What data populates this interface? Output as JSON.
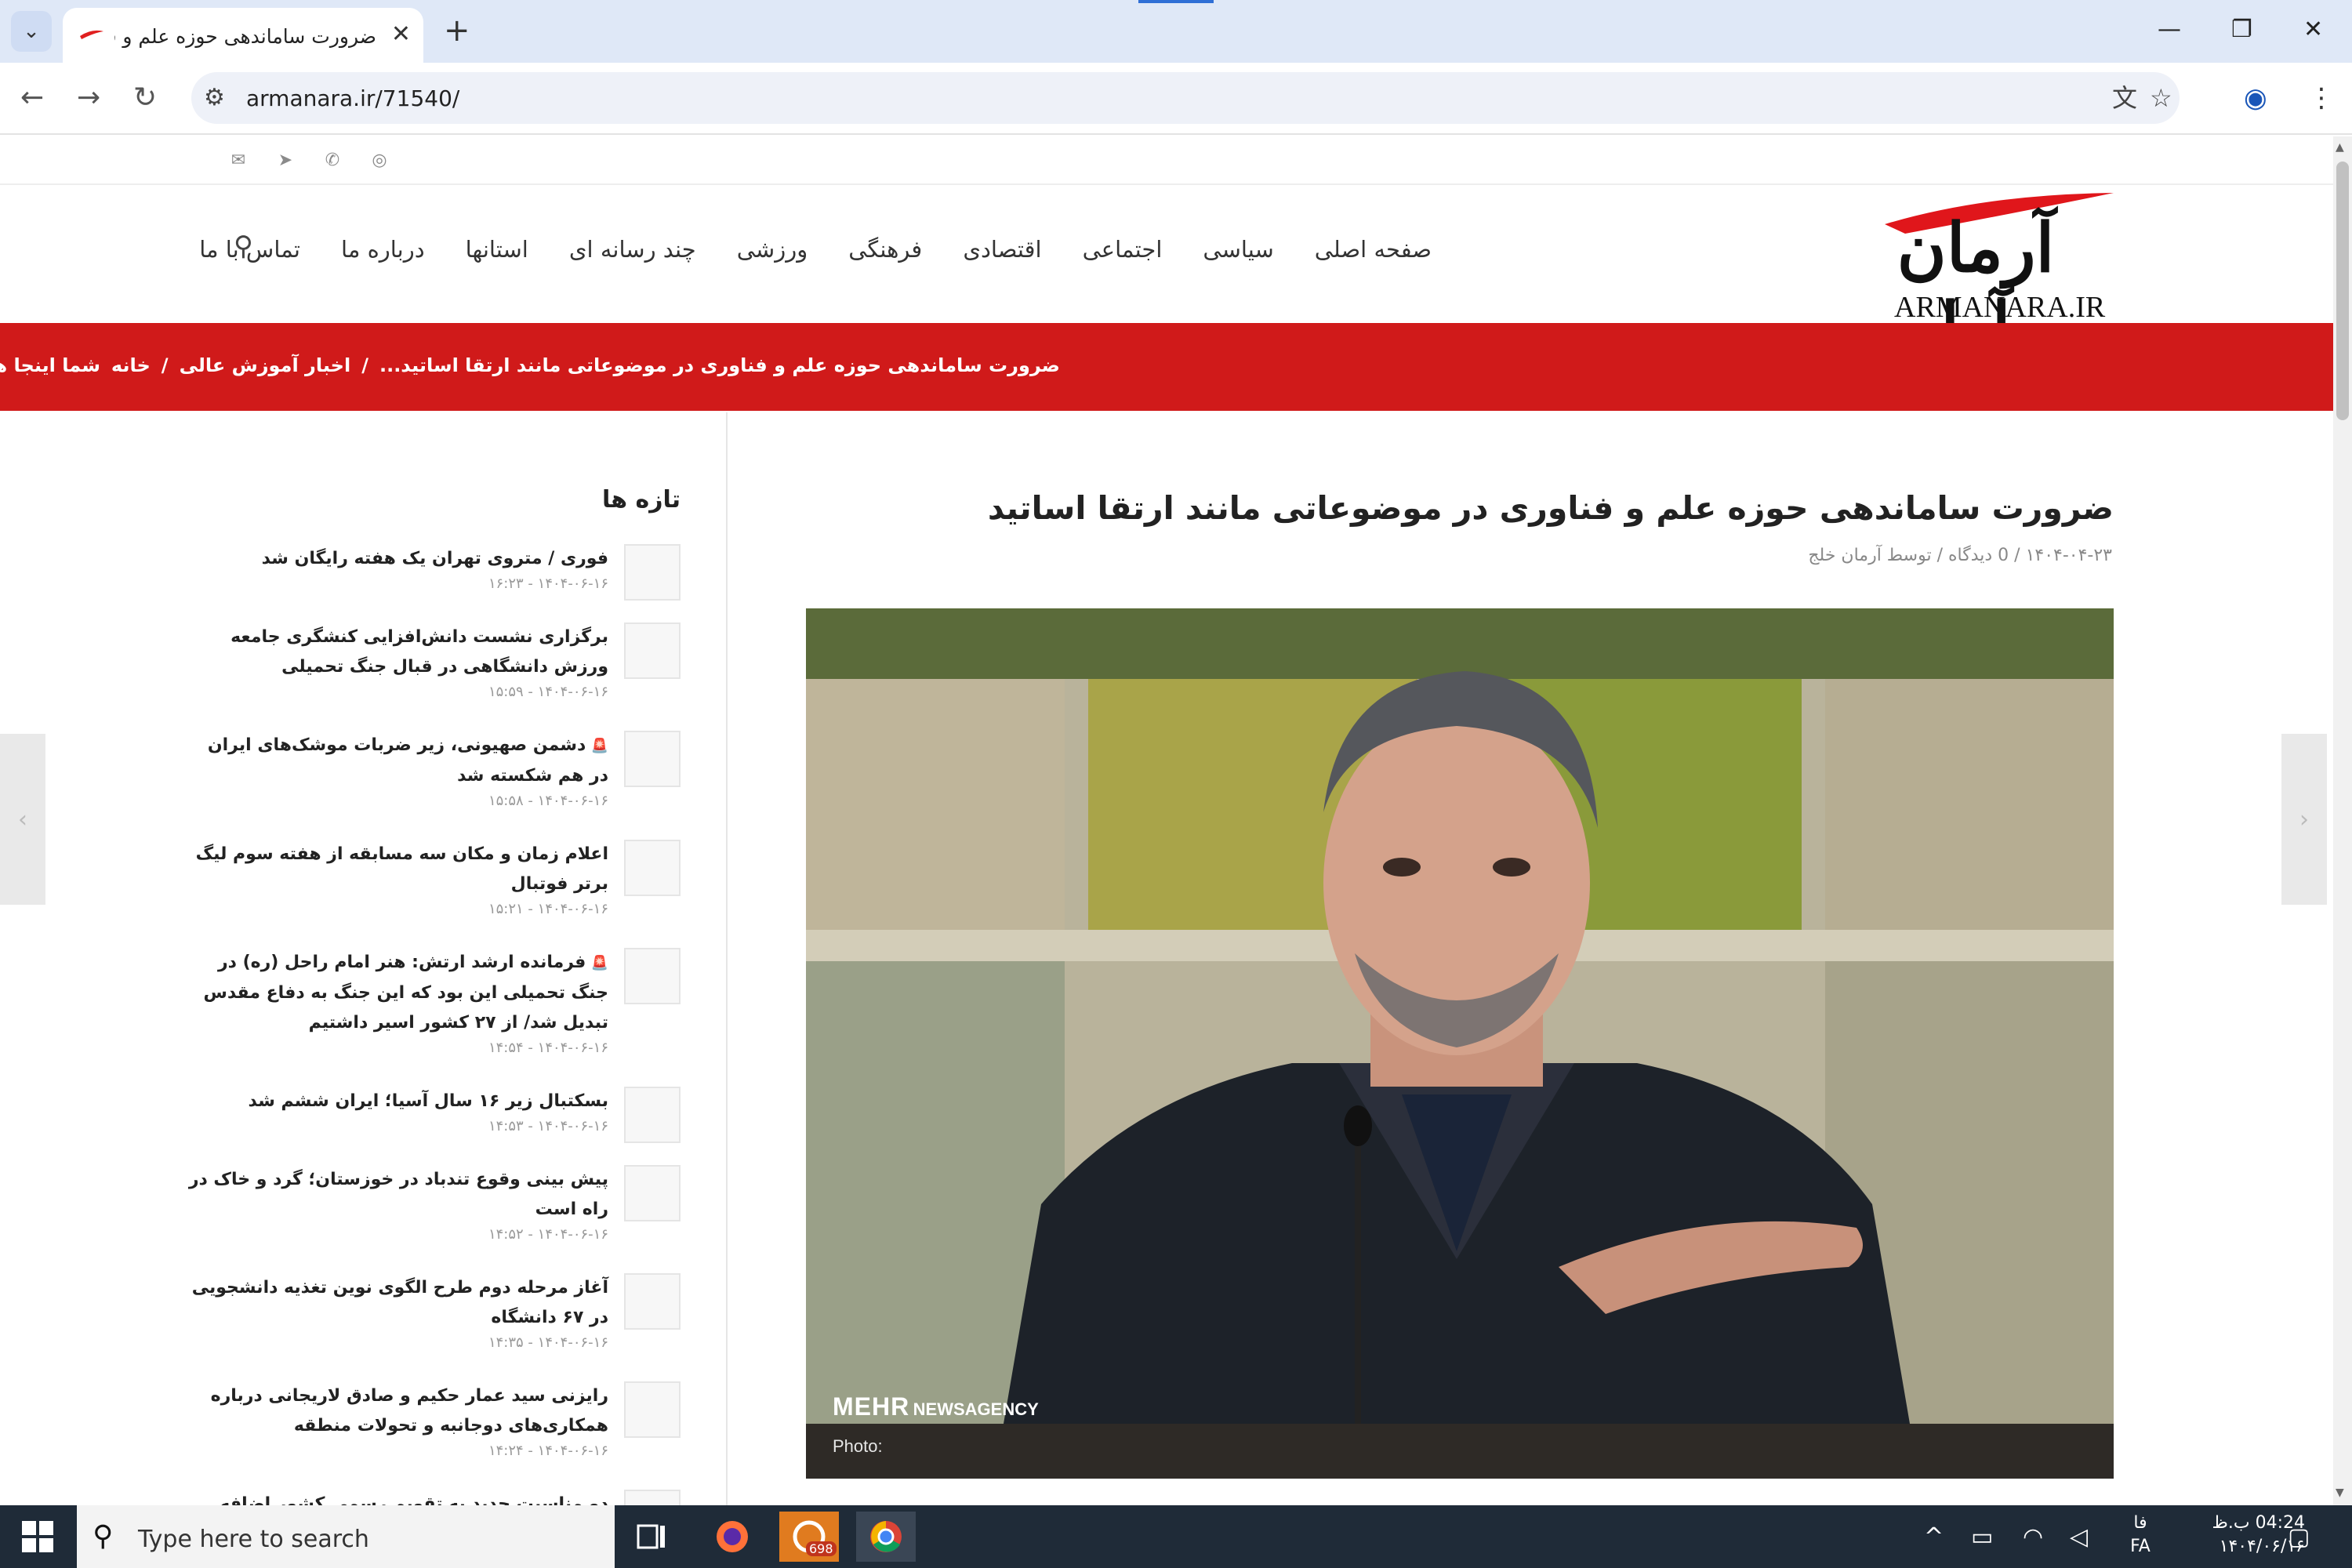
{
  "browser": {
    "tab_title": "ضرورت ساماندهی حوزه علم و فناوری",
    "url": "armanara.ir/71540/",
    "new_tab_glyph": "+",
    "close_glyph": "✕"
  },
  "site": {
    "logo_text": "آرمان آرا",
    "logo_latin": "ARMANARA.IR",
    "nav": [
      "صفحه اصلی",
      "سیاسی",
      "اجتماعی",
      "اقتصادی",
      "فرهنگی",
      "ورزشی",
      "چند رسانه ای",
      "استانها",
      "درباره ما",
      "تماس با ما"
    ],
    "breadcrumb": {
      "prefix": "شما اینجا هستید:",
      "home": "خانه",
      "sep": "/",
      "category": "اخبار آموزش عالی",
      "current": "ضرورت ساماندهی حوزه علم و فناوری در موضوعاتی مانند ارتقا اساتید..."
    }
  },
  "article": {
    "title": "ضرورت ساماندهی حوزه علم و فناوری در موضوعاتی مانند ارتقا اساتید",
    "meta": "۱۴۰۴-۰۴-۲۳ / 0 دیدگاه / توسط آرمان خلج",
    "watermark_main": "MEHR",
    "watermark_sub": "NEWSAGENCY",
    "watermark_photo": "Photo:"
  },
  "sidebar": {
    "title": "تازه ها",
    "items": [
      {
        "title": "فوری / متروی تهران یک هفته رایگان شد",
        "date": "۱۴۰۴-۰۶-۱۶ - ۱۶:۲۳",
        "alert": false
      },
      {
        "title": "برگزاری نشست دانش‌افزایی کنشگری جامعه ورزش دانشگاهی در قبال جنگ تحمیلی",
        "date": "۱۴۰۴-۰۶-۱۶ - ۱۵:۵۹",
        "alert": false
      },
      {
        "title": "دشمن صهیونی، زیر ضربات موشک‌های ایران در هم شکسته شد",
        "date": "۱۴۰۴-۰۶-۱۶ - ۱۵:۵۸",
        "alert": true
      },
      {
        "title": "اعلام زمان و مکان سه مسابقه از هفته سوم لیگ برتر فوتبال",
        "date": "۱۴۰۴-۰۶-۱۶ - ۱۵:۲۱",
        "alert": false
      },
      {
        "title": "فرمانده ارشد ارتش: هنر امام راحل (ره) در جنگ تحمیلی این بود که این جنگ به دفاع مقدس تبدیل شد/ از ۲۷ کشور اسیر داشتیم",
        "date": "۱۴۰۴-۰۶-۱۶ - ۱۴:۵۴",
        "alert": true
      },
      {
        "title": "بسکتبال زیر ۱۶ سال آسیا؛ ایران ششم شد",
        "date": "۱۴۰۴-۰۶-۱۶ - ۱۴:۵۳",
        "alert": false
      },
      {
        "title": "پیش بینی وقوع تندباد در خوزستان؛ گرد و خاک در راه است",
        "date": "۱۴۰۴-۰۶-۱۶ - ۱۴:۵۲",
        "alert": false
      },
      {
        "title": "آغاز مرحله دوم طرح الگوی نوین تغذیه دانشجویی در ۶۷ دانشگاه",
        "date": "۱۴۰۴-۰۶-۱۶ - ۱۴:۳۵",
        "alert": false
      },
      {
        "title": "رایزنی سید عمار حکیم و صادق لاریجانی درباره همکاری‌های دوجانبه و تحولات منطقه",
        "date": "۱۴۰۴-۰۶-۱۶ - ۱۴:۲۴",
        "alert": false
      },
      {
        "title": "دو مناسبت جدید به تقویم رسمی کشور اضافه شد /",
        "date": "",
        "alert": false
      }
    ]
  },
  "taskbar": {
    "search_placeholder": "Type here to search",
    "badge": "698",
    "lang_top": "فا",
    "lang_bottom": "FA",
    "time": "04:24 ب.ظ",
    "date": "۱۴۰۴/۰۶/۱۶"
  },
  "colors": {
    "brand_red": "#d01a1a",
    "taskbar": "#1f2b38",
    "tabbar": "#dfe8f7"
  }
}
